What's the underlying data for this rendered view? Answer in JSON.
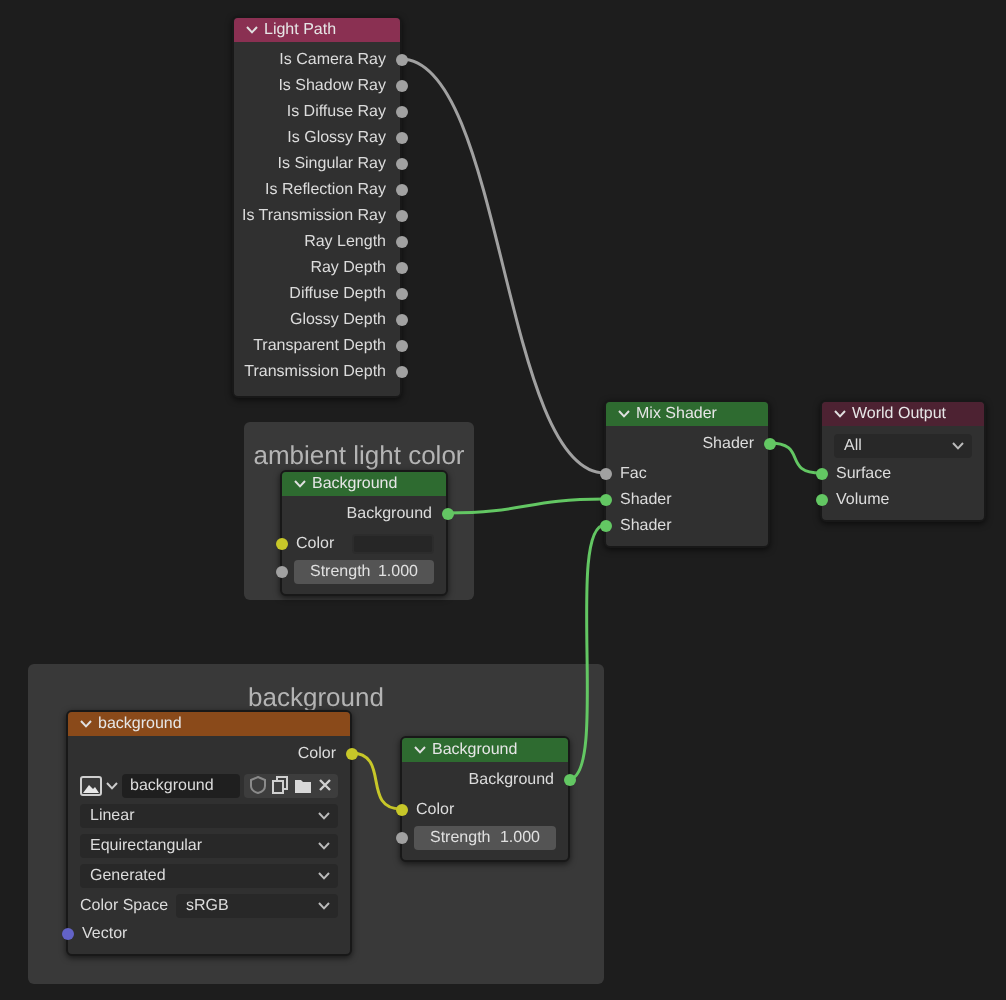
{
  "frames": [
    {
      "label": "ambient light color"
    },
    {
      "label": "background"
    }
  ],
  "nodes": [
    {
      "title": "Light Path",
      "color": "#8a3052",
      "outputs": [
        {
          "label": "Is Camera Ray",
          "color": "#a1a1a1"
        },
        {
          "label": "Is Shadow Ray",
          "color": "#a1a1a1"
        },
        {
          "label": "Is Diffuse Ray",
          "color": "#a1a1a1"
        },
        {
          "label": "Is Glossy Ray",
          "color": "#a1a1a1"
        },
        {
          "label": "Is Singular Ray",
          "color": "#a1a1a1"
        },
        {
          "label": "Is Reflection Ray",
          "color": "#a1a1a1"
        },
        {
          "label": "Is Transmission Ray",
          "color": "#a1a1a1"
        },
        {
          "label": "Ray Length",
          "color": "#a1a1a1"
        },
        {
          "label": "Ray Depth",
          "color": "#a1a1a1"
        },
        {
          "label": "Diffuse Depth",
          "color": "#a1a1a1"
        },
        {
          "label": "Glossy Depth",
          "color": "#a1a1a1"
        },
        {
          "label": "Transparent Depth",
          "color": "#a1a1a1"
        },
        {
          "label": "Transmission Depth",
          "color": "#a1a1a1"
        }
      ]
    },
    {
      "title": "Background",
      "color": "#2e6b30",
      "outputs": [
        {
          "label": "Background",
          "color": "#63c763"
        }
      ],
      "inputs": [
        {
          "kind": "color",
          "label": "Color",
          "color": "#c7c729"
        },
        {
          "kind": "value",
          "label": "Strength",
          "value": "1.000",
          "color": "#a1a1a1"
        }
      ]
    },
    {
      "title": "Mix Shader",
      "color": "#2e6b30",
      "outputs": [
        {
          "label": "Shader",
          "color": "#63c763"
        }
      ],
      "inputs": [
        {
          "kind": "socket",
          "label": "Fac",
          "color": "#a1a1a1"
        },
        {
          "kind": "socket",
          "label": "Shader",
          "color": "#63c763"
        },
        {
          "kind": "socket",
          "label": "Shader",
          "color": "#63c763"
        }
      ]
    },
    {
      "title": "World Output",
      "color": "#4d2232",
      "inputs": [
        {
          "kind": "dropdown",
          "value": "All"
        },
        {
          "kind": "socket",
          "label": "Surface",
          "color": "#63c763"
        },
        {
          "kind": "socket",
          "label": "Volume",
          "color": "#63c763"
        }
      ]
    },
    {
      "title": "background",
      "color": "#8a4a1a",
      "outputs": [
        {
          "label": "Color",
          "color": "#c7c729"
        }
      ],
      "inputs": [
        {
          "kind": "image",
          "value": "background"
        },
        {
          "kind": "dropdown",
          "value": "Linear"
        },
        {
          "kind": "dropdown",
          "value": "Equirectangular"
        },
        {
          "kind": "dropdown",
          "value": "Generated"
        },
        {
          "kind": "labeled_dropdown",
          "label": "Color Space",
          "value": "sRGB"
        },
        {
          "kind": "socket",
          "label": "Vector",
          "color": "#6363c7"
        }
      ]
    },
    {
      "title": "Background",
      "color": "#2e6b30",
      "outputs": [
        {
          "label": "Background",
          "color": "#63c763"
        }
      ],
      "inputs": [
        {
          "kind": "socket",
          "label": "Color",
          "color": "#c7c729"
        },
        {
          "kind": "value",
          "label": "Strength",
          "value": "1.000",
          "color": "#a1a1a1"
        }
      ]
    }
  ]
}
